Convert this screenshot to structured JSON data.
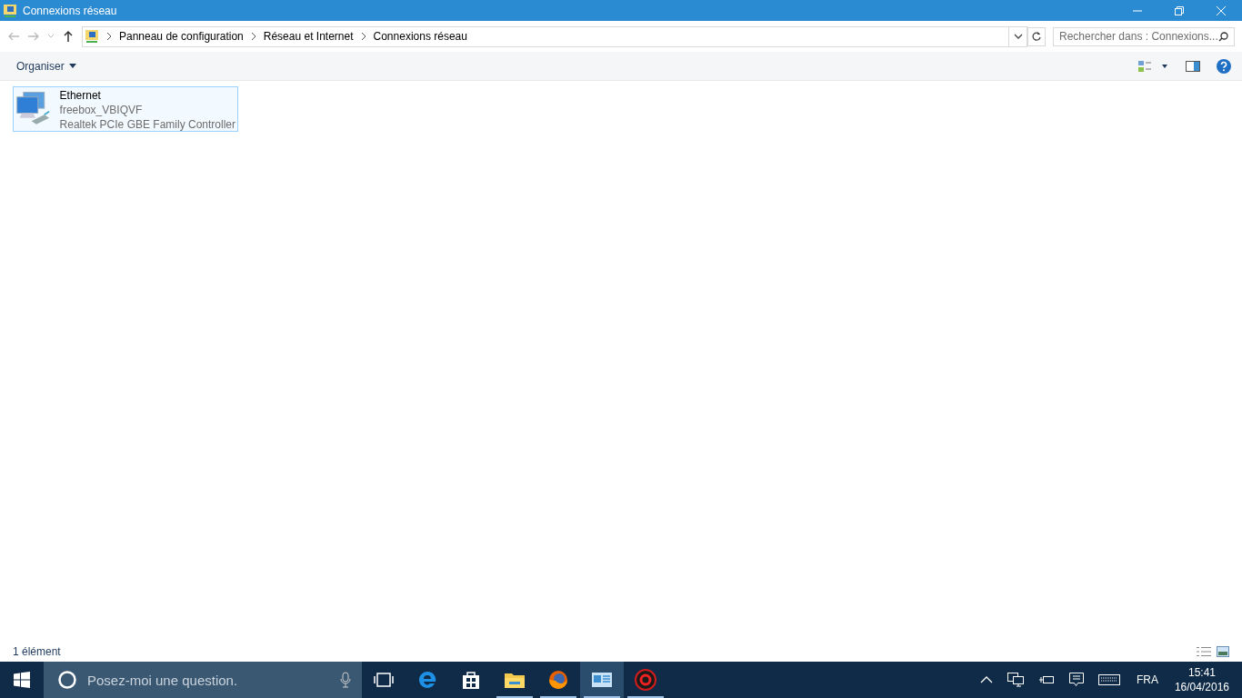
{
  "window": {
    "title": "Connexions réseau"
  },
  "address_bar": {
    "breadcrumbs": [
      "Panneau de configuration",
      "Réseau et Internet",
      "Connexions réseau"
    ]
  },
  "search": {
    "placeholder": "Rechercher dans : Connexions..."
  },
  "command_bar": {
    "organize": "Organiser"
  },
  "connections": [
    {
      "name": "Ethernet",
      "network": "freebox_VBIQVF",
      "adapter": "Realtek PCIe GBE Family Controller",
      "selected": true
    }
  ],
  "status_bar": {
    "count": "1 élément"
  },
  "taskbar": {
    "search_placeholder": "Posez-moi une question.",
    "apps": [
      {
        "kind": "taskview",
        "running": false,
        "selected": false
      },
      {
        "kind": "edge",
        "running": false,
        "selected": false
      },
      {
        "kind": "store",
        "running": false,
        "selected": false
      },
      {
        "kind": "explorer",
        "running": true,
        "selected": false
      },
      {
        "kind": "firefox",
        "running": true,
        "selected": false
      },
      {
        "kind": "controlpanel",
        "running": true,
        "selected": true
      },
      {
        "kind": "redapp",
        "running": true,
        "selected": false
      }
    ],
    "language": "FRA",
    "time": "15:41",
    "date": "16/04/2016"
  }
}
